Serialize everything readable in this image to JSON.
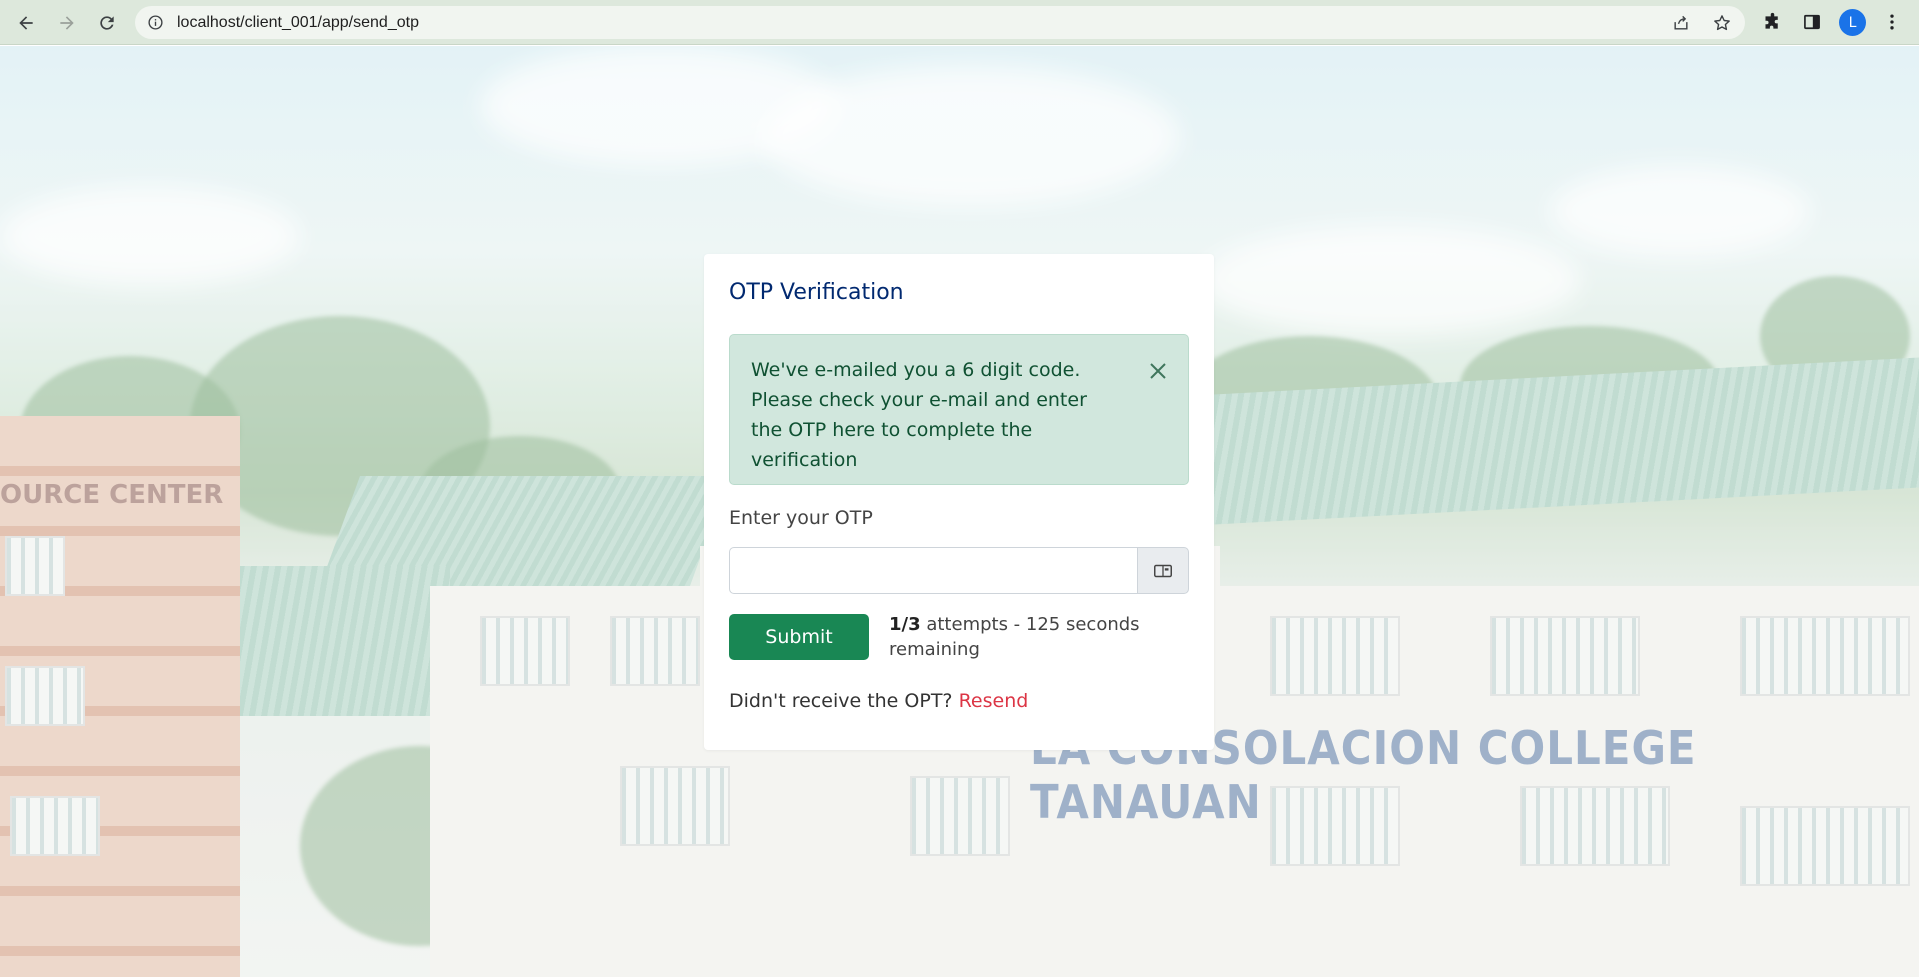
{
  "browser": {
    "url": "localhost/client_001/app/send_otp",
    "avatar_letter": "L",
    "icons": [
      "back-arrow-icon",
      "forward-arrow-icon",
      "reload-icon",
      "info-icon",
      "share-icon",
      "star-icon",
      "extensions-icon",
      "side-panel-icon",
      "menu-dots-icon"
    ]
  },
  "background": {
    "college_sign": "LA CONSOLACION COLLEGE TANAUAN",
    "center_sign": "OURCE CENTER"
  },
  "card": {
    "title": "OTP Verification",
    "alert": {
      "message": "We've e-mailed you a 6 digit code. Please check your e-mail and enter the OTP here to complete the verification",
      "color": "#d1e7dd"
    },
    "otp_label": "Enter your OTP",
    "otp_value": "",
    "submit_label": "Submit",
    "attempts_count": "1/3",
    "attempts_text": " attempts - 125 seconds remaining",
    "resend_prompt": "Didn't receive the OPT? ",
    "resend_label": "Resend"
  },
  "colors": {
    "title": "#012970",
    "submit": "#198754",
    "resend": "#dc3545"
  }
}
